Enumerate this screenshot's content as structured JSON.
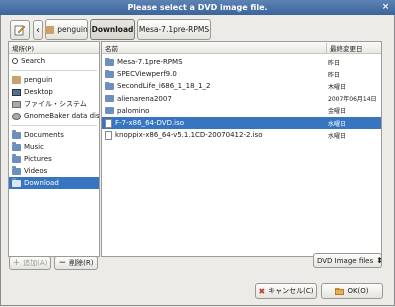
{
  "window": {
    "title": "Please select a DVD image file.",
    "close_glyph": "×"
  },
  "toolbar": {
    "edit_icon": "pencil-icon",
    "back_glyph": "‹",
    "breadcrumbs": [
      {
        "label": "penguin",
        "icon": "home-folder-icon"
      },
      {
        "label": "Download",
        "active": true
      },
      {
        "label": "Mesa-7.1pre-RPMS"
      }
    ]
  },
  "places": {
    "header": "場所(P)",
    "items": [
      {
        "label": "Search",
        "icon": "search-icon"
      },
      {
        "label": "penguin",
        "icon": "home-folder-icon"
      },
      {
        "label": "Desktop",
        "icon": "desktop-icon"
      },
      {
        "label": "ファイル・システム",
        "icon": "harddisk-icon"
      },
      {
        "label": "GnomeBaker data disk",
        "icon": "disk-icon"
      },
      {
        "label": "Documents",
        "icon": "folder-icon"
      },
      {
        "label": "Music",
        "icon": "folder-icon"
      },
      {
        "label": "Pictures",
        "icon": "folder-icon"
      },
      {
        "label": "Videos",
        "icon": "folder-icon"
      },
      {
        "label": "Download",
        "icon": "folder-icon",
        "selected": true
      }
    ],
    "add_label": "追加(A)",
    "remove_label": "削除(R)"
  },
  "files": {
    "col_name": "名前",
    "col_modified": "最終変更日",
    "rows": [
      {
        "name": "Mesa-7.1pre-RPMS",
        "modified": "昨日",
        "type": "folder"
      },
      {
        "name": "SPECViewperf9.0",
        "modified": "昨日",
        "type": "folder"
      },
      {
        "name": "SecondLife_i686_1_18_1_2",
        "modified": "木曜日",
        "type": "folder"
      },
      {
        "name": "alienarena2007",
        "modified": "2007年06月14日",
        "type": "folder"
      },
      {
        "name": "palomino",
        "modified": "金曜日",
        "type": "folder"
      },
      {
        "name": "F-7-x86_64-DVD.iso",
        "modified": "水曜日",
        "type": "file",
        "selected": true
      },
      {
        "name": "knoppix-x86_64-v5.1.1CD-20070412-2.iso",
        "modified": "水曜日",
        "type": "file"
      }
    ]
  },
  "filter": {
    "value": "DVD Image files",
    "arrow": "⬍"
  },
  "footer": {
    "cancel_label": "キャンセル(C)",
    "ok_label": "OK(O)"
  },
  "colors": {
    "selection": "#3875c0",
    "titlebar": "#4a72a8",
    "cancel_icon": "#c0392b",
    "ok_icon": "#d28a1e"
  }
}
